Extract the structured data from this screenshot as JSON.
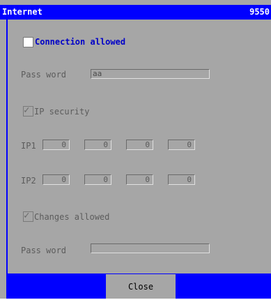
{
  "window": {
    "title": "Internet",
    "title_right": "9550"
  },
  "connection": {
    "label": "Connection allowed",
    "checked": false
  },
  "password1": {
    "label": "Pass word",
    "value": "aa"
  },
  "ip_security": {
    "label": "IP security",
    "checked": true
  },
  "ip1": {
    "label": "IP1",
    "octets": [
      "0",
      "0",
      "0",
      "0"
    ]
  },
  "ip2": {
    "label": "IP2",
    "octets": [
      "0",
      "0",
      "0",
      "0"
    ]
  },
  "changes": {
    "label": "Changes allowed",
    "checked": true
  },
  "password2": {
    "label": "Pass word",
    "value": ""
  },
  "footer": {
    "close_label": "Close"
  },
  "colors": {
    "titlebar": "#0000ff",
    "panel": "#a6a6a6",
    "accent_text": "#0000c8"
  }
}
